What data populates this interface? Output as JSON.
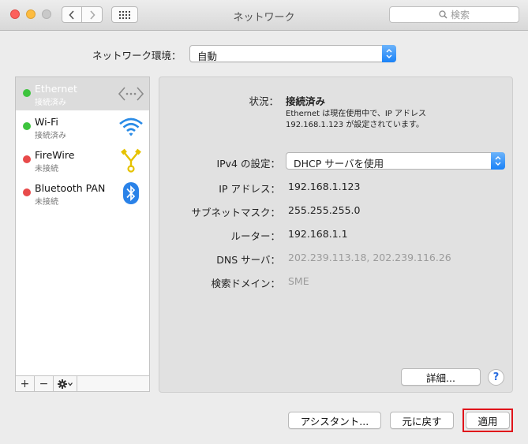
{
  "window": {
    "title": "ネットワーク"
  },
  "search": {
    "placeholder": "検索"
  },
  "location": {
    "label": "ネットワーク環境：",
    "value": "自動"
  },
  "services": [
    {
      "name": "Ethernet",
      "status": "接続済み",
      "status_color": "#3dc43d",
      "icon": "ethernet-icon"
    },
    {
      "name": "Wi-Fi",
      "status": "接続済み",
      "status_color": "#3dc43d",
      "icon": "wifi-icon"
    },
    {
      "name": "FireWire",
      "status": "未接続",
      "status_color": "#e84a4a",
      "icon": "firewire-icon"
    },
    {
      "name": "Bluetooth PAN",
      "status": "未接続",
      "status_color": "#e84a4a",
      "icon": "bluetooth-icon"
    }
  ],
  "sidebar_toolbar": {
    "add": "+",
    "remove": "−"
  },
  "detail": {
    "status_label": "状況：",
    "status_value": "接続済み",
    "status_desc_line1": "Ethernet は現在使用中で、IP アドレス",
    "status_desc_line2": "192.168.1.123 が設定されています。",
    "ipv4_label": "IPv4 の設定：",
    "ipv4_value": "DHCP サーバを使用",
    "ip_label": "IP アドレス：",
    "ip_value": "192.168.1.123",
    "subnet_label": "サブネットマスク：",
    "subnet_value": "255.255.255.0",
    "router_label": "ルーター：",
    "router_value": "192.168.1.1",
    "dns_label": "DNS サーバ：",
    "dns_value": "202.239.113.18, 202.239.116.26",
    "search_domain_label": "検索ドメイン：",
    "search_domain_value": "SME",
    "advanced_button": "詳細...",
    "help_button": "?"
  },
  "footer": {
    "assistant_button": "アシスタント...",
    "revert_button": "元に戻す",
    "apply_button": "適用"
  },
  "colors": {
    "accent": "#1a82f8",
    "highlight": "#e0141b"
  }
}
